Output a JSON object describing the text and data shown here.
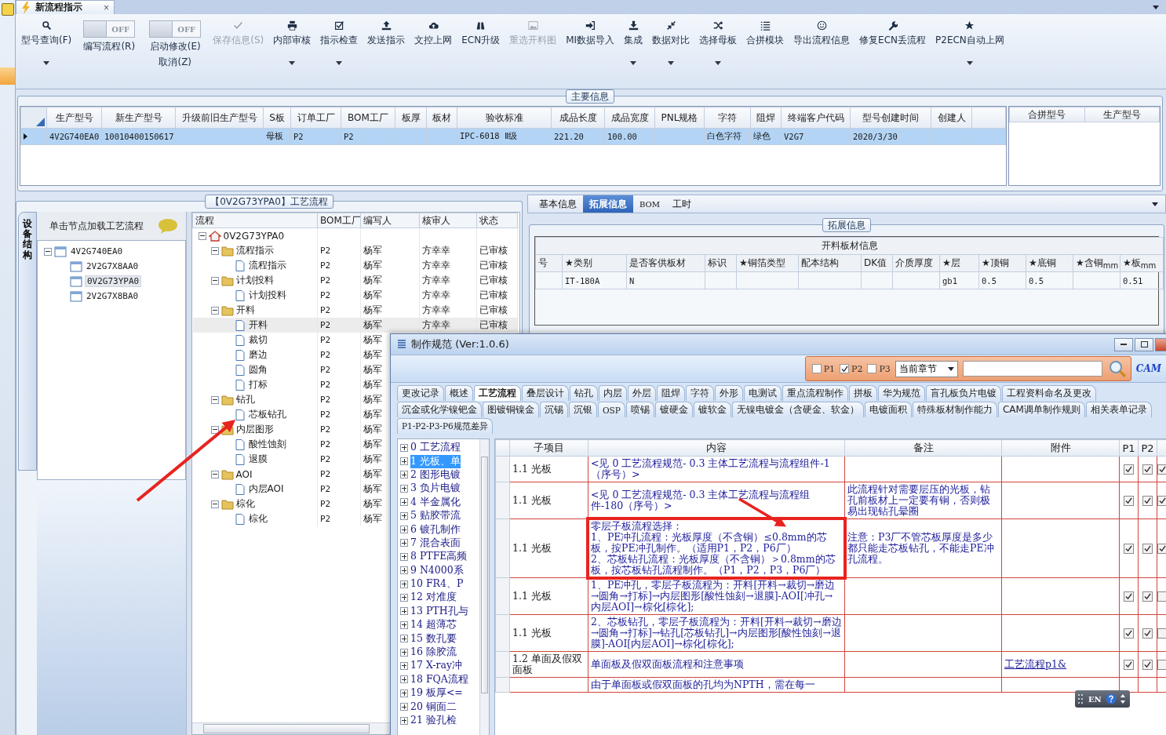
{
  "document_tab": {
    "title": "新流程指示",
    "close": "×"
  },
  "toolbar": [
    {
      "kind": "button",
      "label": "型号查询(F)",
      "disabled": false,
      "dropdown": true
    },
    {
      "kind": "toggle",
      "label": "编写流程(R)",
      "switch_text": "OFF",
      "on": false
    },
    {
      "kind": "toggle",
      "label": "启动修改(E)",
      "sublabel": "取消(Z)",
      "switch_text": "OFF",
      "on": false
    },
    {
      "kind": "button",
      "label": "保存信息(S)",
      "disabled": true,
      "dropdown": false
    },
    {
      "kind": "button",
      "label": "内部审核",
      "disabled": false,
      "dropdown": true
    },
    {
      "kind": "button",
      "label": "指示检查",
      "disabled": false,
      "dropdown": true
    },
    {
      "kind": "button",
      "label": "发送指示",
      "disabled": false,
      "dropdown": false
    },
    {
      "kind": "button",
      "label": "文控上网",
      "disabled": false,
      "dropdown": false
    },
    {
      "kind": "button",
      "label": "ECN升级",
      "disabled": false,
      "dropdown": false
    },
    {
      "kind": "button",
      "label": "重选开料图",
      "disabled": true,
      "dropdown": false
    },
    {
      "kind": "button",
      "label": "MI数据导入",
      "disabled": false,
      "dropdown": false
    },
    {
      "kind": "button",
      "label": "集成",
      "disabled": false,
      "dropdown": true
    },
    {
      "kind": "button",
      "label": "数据对比",
      "disabled": false,
      "dropdown": true
    },
    {
      "kind": "button",
      "label": "选择母板",
      "disabled": false,
      "dropdown": true
    },
    {
      "kind": "button",
      "label": "合拼模块",
      "disabled": false,
      "dropdown": false
    },
    {
      "kind": "button",
      "label": "导出流程信息",
      "disabled": false,
      "dropdown": false
    },
    {
      "kind": "button",
      "label": "修复ECN丢流程",
      "disabled": false,
      "dropdown": false
    },
    {
      "kind": "button",
      "label": "P2ECN自动上网",
      "disabled": false,
      "dropdown": true
    }
  ],
  "main_info": {
    "legend": "主要信息",
    "columns": [
      "生产型号",
      "新生产型号",
      "升级前旧生产型号",
      "S板",
      "订单工厂",
      "BOM工厂",
      "板厚",
      "板材",
      "验收标准",
      "成品长度",
      "成品宽度",
      "PNL规格",
      "字符",
      "阻焊",
      "终端客户代码",
      "型号创建时间",
      "创建人"
    ],
    "rows": [
      {
        "selected": true,
        "cells": [
          "4V2G740EA0",
          "10010400150617",
          null,
          "母板",
          "P2",
          "P2",
          null,
          null,
          "IPC-6018 Ⅱ级",
          "221.20",
          "100.00",
          null,
          "白色字符",
          "绿色",
          "V2G7",
          "2020/3/30",
          null
        ]
      }
    ],
    "side_columns": [
      "合拼型号",
      "生产型号"
    ]
  },
  "process_panel": {
    "legend": "【0V2G73YPA0】工艺流程",
    "side_tab": {
      "label": "设备结构",
      "selected": true
    },
    "model_tree": {
      "hint": "单击节点加载工艺流程",
      "nodes": [
        {
          "label": "4V2G740EA0",
          "selected": false,
          "expanded": true,
          "children": [
            {
              "label": "2V2G7X8AA0",
              "selected": false
            },
            {
              "label": "0V2G73YPA0",
              "selected": true
            },
            {
              "label": "2V2G7X8BA0",
              "selected": false
            }
          ]
        }
      ]
    },
    "grid": {
      "columns": [
        "流程",
        "BOM工厂",
        "编写人",
        "核审人",
        "状态"
      ],
      "rows": [
        {
          "kind": "home",
          "label": "0V2G73YPA0",
          "selected": false,
          "expanded": true,
          "children": [
            {
              "kind": "folder",
              "label": "流程指示",
              "bom": "P2",
              "writer": "杨军",
              "reviewer": "方幸幸",
              "status": "已审核",
              "selected": false,
              "expanded": true,
              "children": [
                {
                  "kind": "page",
                  "label": "流程指示",
                  "bom": "P2",
                  "writer": "杨军",
                  "reviewer": "方幸幸",
                  "status": "已审核",
                  "selected": false
                }
              ]
            },
            {
              "kind": "folder",
              "label": "计划投料",
              "bom": "P2",
              "writer": "杨军",
              "reviewer": "方幸幸",
              "status": "已审核",
              "selected": false,
              "expanded": true,
              "children": [
                {
                  "kind": "page",
                  "label": "计划投料",
                  "bom": "P2",
                  "writer": "杨军",
                  "reviewer": "方幸幸",
                  "status": "已审核",
                  "selected": false
                }
              ]
            },
            {
              "kind": "folder",
              "label": "开料",
              "bom": "P2",
              "writer": "杨军",
              "reviewer": "方幸幸",
              "status": "已审核",
              "selected": false,
              "expanded": true,
              "children": [
                {
                  "kind": "page",
                  "label": "开料",
                  "bom": "P2",
                  "writer": "杨军",
                  "reviewer": "方幸幸",
                  "status": "已审核",
                  "selected": true
                },
                {
                  "kind": "page",
                  "label": "裁切",
                  "bom": "P2",
                  "writer": "杨军",
                  "selected": false
                },
                {
                  "kind": "page",
                  "label": "磨边",
                  "bom": "P2",
                  "writer": "杨军",
                  "selected": false
                },
                {
                  "kind": "page",
                  "label": "圆角",
                  "bom": "P2",
                  "writer": "杨军",
                  "selected": false
                },
                {
                  "kind": "page",
                  "label": "打标",
                  "bom": "P2",
                  "writer": "杨军",
                  "selected": false
                }
              ]
            },
            {
              "kind": "folder",
              "label": "钻孔",
              "bom": "P2",
              "writer": "杨军",
              "selected": false,
              "expanded": true,
              "children": [
                {
                  "kind": "page",
                  "label": "芯板钻孔",
                  "bom": "P2",
                  "writer": "杨军",
                  "selected": false
                }
              ]
            },
            {
              "kind": "folder",
              "label": "内层图形",
              "bom": "P2",
              "writer": "杨军",
              "selected": false,
              "expanded": true,
              "children": [
                {
                  "kind": "page",
                  "label": "酸性蚀刻",
                  "bom": "P2",
                  "writer": "杨军",
                  "selected": false
                },
                {
                  "kind": "page",
                  "label": "退膜",
                  "bom": "P2",
                  "writer": "杨军",
                  "selected": false
                }
              ]
            },
            {
              "kind": "folder",
              "label": "AOI",
              "bom": "P2",
              "writer": "杨军",
              "selected": false,
              "expanded": true,
              "children": [
                {
                  "kind": "page",
                  "label": "内层AOI",
                  "bom": "P2",
                  "writer": "杨军",
                  "selected": false
                }
              ]
            },
            {
              "kind": "folder",
              "label": "棕化",
              "bom": "P2",
              "writer": "杨军",
              "selected": false,
              "expanded": true,
              "children": [
                {
                  "kind": "page",
                  "label": "棕化",
                  "bom": "P2",
                  "writer": "杨军",
                  "selected": false
                }
              ]
            }
          ]
        }
      ]
    }
  },
  "detail_panel": {
    "tabs": [
      {
        "label": "基本信息",
        "selected": false
      },
      {
        "label": "拓展信息",
        "selected": true
      },
      {
        "label": "BOM",
        "selected": false
      },
      {
        "label": "工时",
        "selected": false
      }
    ],
    "legend": "拓展信息",
    "table": {
      "title": "开料板材信息",
      "columns": [
        "号",
        "★类别",
        "是否客供板材",
        "标识",
        "★铜箔类型",
        "配本结构",
        "DK值",
        "介质厚度",
        "★层",
        "★顶铜",
        "★底铜",
        "★含铜$_{mm}$",
        "★板$_{mm}$"
      ],
      "rows": [
        [
          null,
          "IT-180A",
          "N",
          null,
          null,
          null,
          null,
          null,
          "gb1",
          "0.5",
          "0.5",
          null,
          "0.51"
        ]
      ]
    }
  },
  "spec_dialog": {
    "title": "制作规范 (Ver:1.0.6)",
    "filter": {
      "checks": [
        {
          "label": "P1",
          "checked": false
        },
        {
          "label": "P2",
          "checked": true
        },
        {
          "label": "P3",
          "checked": false
        }
      ],
      "scope": "当前章节"
    },
    "logo": "CAM",
    "tab_rows": [
      [
        {
          "label": "更改记录",
          "selected": false
        },
        {
          "label": "概述",
          "selected": false
        },
        {
          "label": "工艺流程",
          "selected": true
        },
        {
          "label": "叠层设计",
          "selected": false
        },
        {
          "label": "钻孔",
          "selected": false
        },
        {
          "label": "内层",
          "selected": false
        },
        {
          "label": "外层",
          "selected": false
        },
        {
          "label": "阻焊",
          "selected": false
        },
        {
          "label": "字符",
          "selected": false
        },
        {
          "label": "外形",
          "selected": false
        },
        {
          "label": "电测试",
          "selected": false
        },
        {
          "label": "重点流程制作",
          "selected": false
        },
        {
          "label": "拼板",
          "selected": false
        },
        {
          "label": "华为规范",
          "selected": false
        },
        {
          "label": "盲孔板负片电镀",
          "selected": false
        },
        {
          "label": "工程资料命名及更改",
          "selected": false
        }
      ],
      [
        {
          "label": "沉金或化学镍钯金",
          "selected": false
        },
        {
          "label": "图镀铜镍金",
          "selected": false
        },
        {
          "label": "沉锡",
          "selected": false
        },
        {
          "label": "沉银",
          "selected": false
        },
        {
          "label": "OSP",
          "selected": false
        },
        {
          "label": "喷锡",
          "selected": false
        },
        {
          "label": "镀硬金",
          "selected": false
        },
        {
          "label": "镀软金",
          "selected": false
        },
        {
          "label": "无镍电镀金（含硬金、软金）",
          "selected": false
        },
        {
          "label": "电镀面积",
          "selected": false
        },
        {
          "label": "特殊板材制作能力",
          "selected": false
        },
        {
          "label": "CAM调单制作规则",
          "selected": false
        },
        {
          "label": "相关表单记录",
          "selected": false
        }
      ],
      [
        {
          "label": "P1-P2-P3-P6规范差异",
          "selected": false
        }
      ]
    ],
    "chapters": [
      {
        "label": "0 工艺流程",
        "selected": false
      },
      {
        "label": "1 光板、单",
        "selected": true
      },
      {
        "label": "2 图形电镀",
        "selected": false
      },
      {
        "label": "3 负片电镀",
        "selected": false
      },
      {
        "label": "4 半金属化",
        "selected": false
      },
      {
        "label": "5 贴胶带流",
        "selected": false
      },
      {
        "label": "6 镀孔制作",
        "selected": false
      },
      {
        "label": "7 混合表面",
        "selected": false
      },
      {
        "label": "8 PTFE高频",
        "selected": false
      },
      {
        "label": "9 N4000系",
        "selected": false
      },
      {
        "label": "10 FR4、P",
        "selected": false
      },
      {
        "label": "12 对准度",
        "selected": false
      },
      {
        "label": "13 PTH孔与",
        "selected": false
      },
      {
        "label": "14 超薄芯",
        "selected": false
      },
      {
        "label": "15 数孔要",
        "selected": false
      },
      {
        "label": "16 除胶流",
        "selected": false
      },
      {
        "label": "17 X-ray冲",
        "selected": false
      },
      {
        "label": "18 FQA流程",
        "selected": false
      },
      {
        "label": "19 板厚<=",
        "selected": false
      },
      {
        "label": "20 铜面二",
        "selected": false
      },
      {
        "label": "21 验孔检",
        "selected": false
      }
    ],
    "grid": {
      "columns": [
        "子项目",
        "内容",
        "备注",
        "附件",
        "P1",
        "P2"
      ],
      "rows": [
        {
          "sub_item": "1.1 光板",
          "content": "<见 0 工艺流程规范- 0.3 主体工艺流程与流程组件-1（序号）>",
          "highlighted": false,
          "checks": [
            true,
            true,
            true
          ]
        },
        {
          "sub_item": "1.1 光板",
          "content": "<见 0 工艺流程规范- 0.3 主体工艺流程与流程组件-180（序号）>",
          "remark": "此流程针对需要层压的光板，钻孔前板材上一定要有铜，否则极易出现钻孔晕圈",
          "highlighted": false,
          "checks": [
            true,
            true,
            true
          ]
        },
        {
          "sub_item": "1.1 光板",
          "content": "零层子板流程选择：\n1、PE冲孔流程：光板厚度（不含铜）≤0.8mm的芯板，按PE冲孔制作。（适用P1，P2，P6厂）\n2、芯板钻孔流程：光板厚度（不含铜）＞0.8mm的芯板，按芯板钻孔流程制作。（P1，P2，P3，P6厂）",
          "remark": "注意：P3厂不管芯板厚度是多少都只能走芯板钻孔，不能走PE冲孔流程。",
          "highlighted": true,
          "checks": [
            true,
            true,
            true
          ]
        },
        {
          "sub_item": "1.1 光板",
          "content": "1、PE冲孔，零层子板流程为：开料[开料→裁切→磨边→圆角→打标]→内层图形[酸性蚀刻→退膜]-AOI[冲孔→内层AOI]→棕化[棕化];",
          "checks": [
            true,
            true,
            false
          ]
        },
        {
          "sub_item": "1.1 光板",
          "content": "2、芯板钻孔，零层子板流程为：开料[开料→裁切→磨边→圆角→打标]→钻孔[芯板钻孔]→内层图形[酸性蚀刻→退膜]-AOI[内层AOI]→棕化[棕化];",
          "checks": [
            true,
            true,
            false
          ]
        },
        {
          "sub_item": "1.2 单面及假双面板",
          "content": "单面板及假双面板流程和注意事项",
          "attachment": "工艺流程p1&",
          "checks": [
            true,
            true,
            false
          ]
        },
        {
          "content": "由于单面板或假双面板的孔均为NPTH，需在每一"
        }
      ]
    }
  },
  "ime_bar": {
    "label": "EN"
  }
}
